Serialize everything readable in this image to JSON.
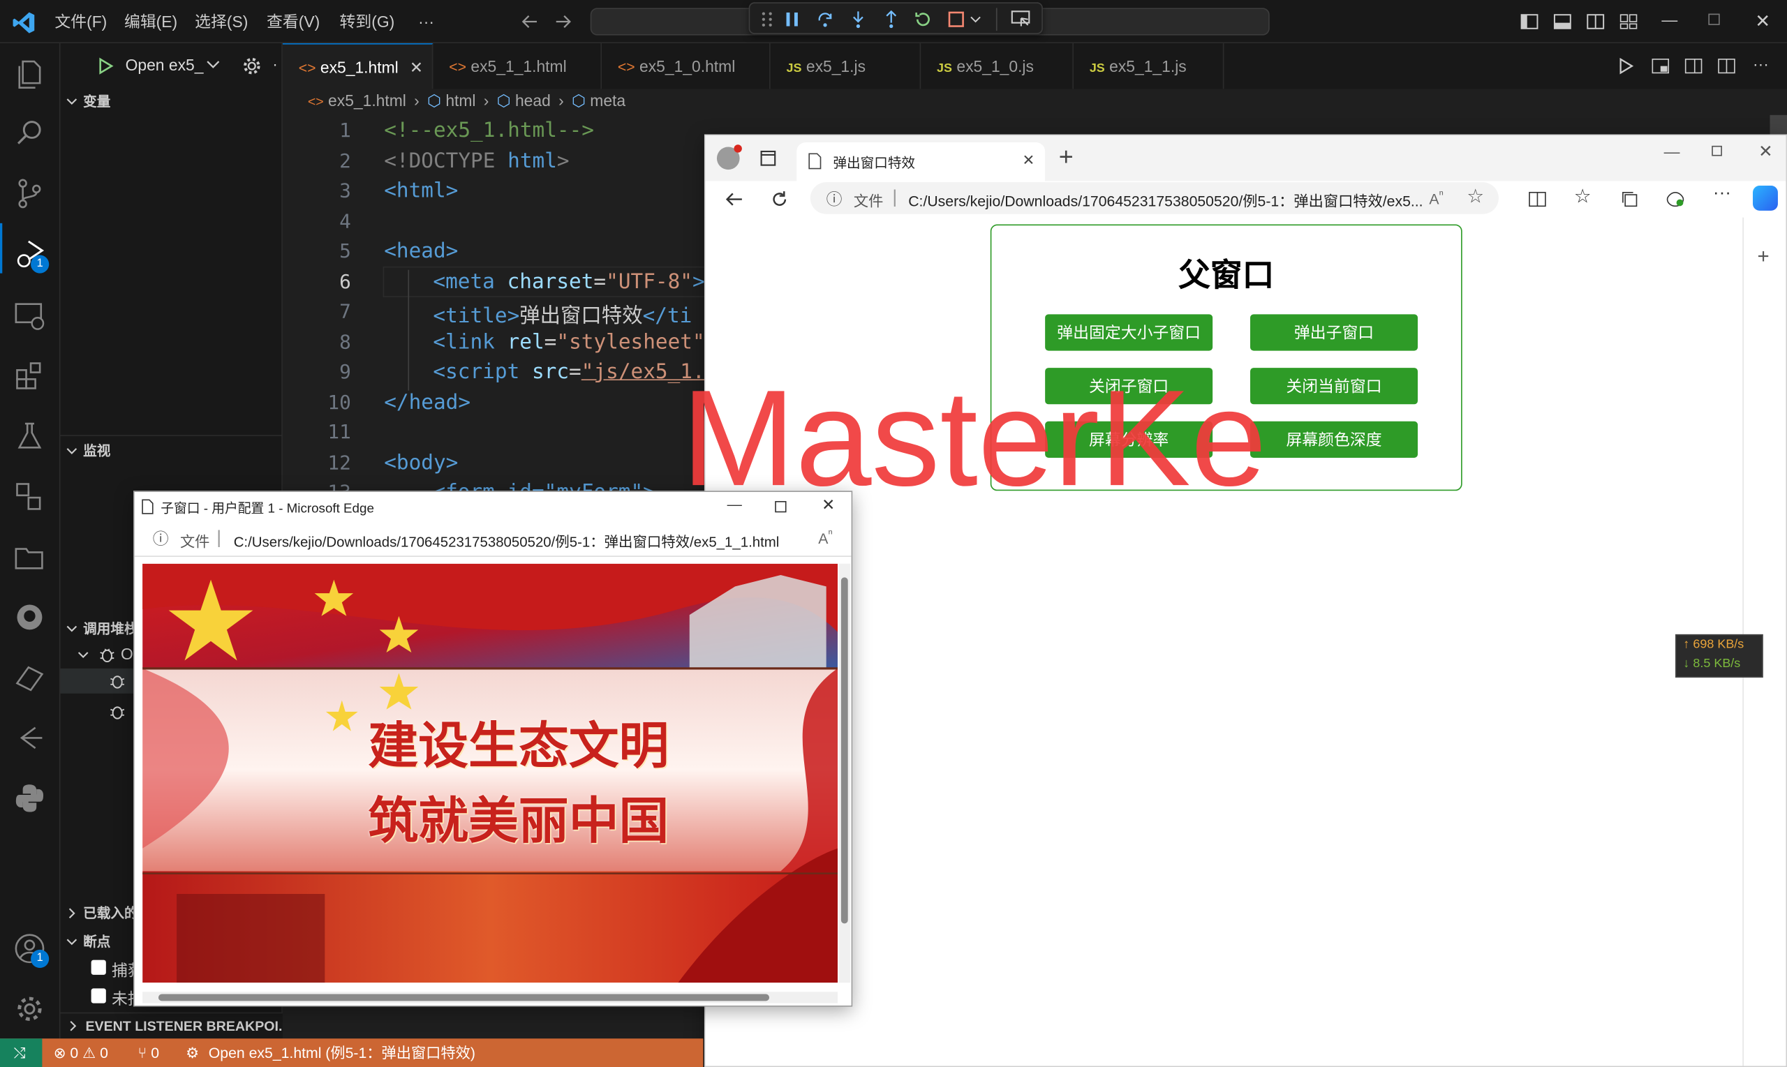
{
  "menu": [
    "文件(F)",
    "编辑(E)",
    "选择(S)",
    "查看(V)",
    "转到(G)",
    "···"
  ],
  "debug_config": {
    "label": "Open ex5_"
  },
  "badges": {
    "run": "1",
    "account": "1"
  },
  "sidebar": {
    "variables": "变量",
    "watch": "监视",
    "callstack": "调用堆栈",
    "callstack_item": "O",
    "loaded": "已载入的",
    "breakpoints": "断点",
    "bp1": "捕获",
    "bp2": "未捕",
    "event_listener": "EVENT LISTENER BREAKPOI..."
  },
  "tabs": [
    {
      "label": "ex5_1.html",
      "kind": "html"
    },
    {
      "label": "ex5_1_1.html",
      "kind": "html"
    },
    {
      "label": "ex5_1_0.html",
      "kind": "html"
    },
    {
      "label": "ex5_1.js",
      "kind": "js"
    },
    {
      "label": "ex5_1_0.js",
      "kind": "js"
    },
    {
      "label": "ex5_1_1.js",
      "kind": "js"
    }
  ],
  "breadcrumb": [
    "ex5_1.html",
    "html",
    "head",
    "meta"
  ],
  "code_lines": [
    "1",
    "2",
    "3",
    "4",
    "5",
    "6",
    "7",
    "8",
    "9",
    "10",
    "11",
    "12",
    "13"
  ],
  "code": {
    "l1": "<!--ex5_1.html-->",
    "l2a": "<!DOCTYPE ",
    "l2b": "html",
    ">": ">",
    "l3": "<html>",
    "l5": "<head>",
    "l6a": "<meta ",
    "l6b": "charset",
    "l6c": "=",
    "l6d": "\"UTF-8\"",
    "l6e": ">",
    "l7a": "<title>",
    "l7b": "弹出窗口特效",
    "l7c": "</ti",
    "l8a": "<link ",
    "l8b": "rel",
    "l8c": "=",
    "l8d": "\"stylesheet\"",
    "l9a": "<script ",
    "l9b": "src",
    "l9c": "=",
    "l9d": "\"js/ex5_1.",
    "l10": "</head>",
    "l12": "<body>",
    "l13": "<form id=\"myForm\">"
  },
  "status": {
    "errors": "0",
    "warnings": "0",
    "ports": "0",
    "debug": "Open ex5_1.html (例5-1：弹出窗口特效)"
  },
  "browser": {
    "tab_title": "弹出窗口特效",
    "address_prefix": "文件",
    "address": "C:/Users/kejio/Downloads/1706452317538050520/例5-1：弹出窗口特效/ex5...",
    "page_title": "父窗口",
    "buttons": [
      "弹出固定大小子窗口",
      "弹出子窗口",
      "关闭子窗口",
      "关闭当前窗口",
      "屏幕分辨率",
      "屏幕颜色深度"
    ]
  },
  "popup": {
    "title": "子窗口 - 用户配置 1 - Microsoft Edge",
    "address_prefix": "文件",
    "address": "C:/Users/kejio/Downloads/1706452317538050520/例5-1：弹出窗口特效/ex5_1_1.html",
    "banner_line1": "建设生态文明",
    "banner_line2": "筑就美丽中国"
  },
  "watermark": "MasterKe",
  "netspeed": {
    "up": "↑ 698 KB/s",
    "down": "↓ 8.5 KB/s"
  },
  "colors": {
    "accent": "#0078d4",
    "status": "#cc6633",
    "button_green": "#2e9b27",
    "watermark": "#f03c3c"
  }
}
